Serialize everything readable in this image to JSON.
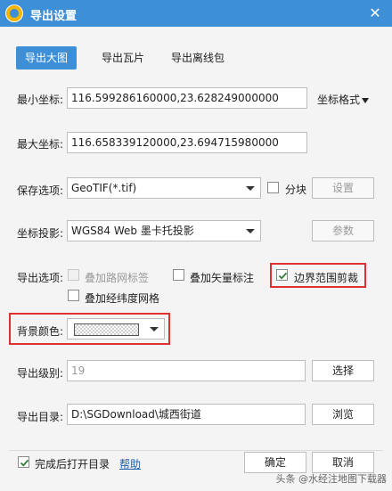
{
  "window": {
    "title": "导出设置",
    "close_glyph": "✕"
  },
  "tabs": [
    {
      "label": "导出大图",
      "active": true
    },
    {
      "label": "导出瓦片",
      "active": false
    },
    {
      "label": "导出离线包",
      "active": false
    }
  ],
  "coords": {
    "min_label": "最小坐标:",
    "min_value": "116.599286160000,23.628249000000",
    "max_label": "最大坐标:",
    "max_value": "116.658339120000,23.694715980000",
    "format_label": "坐标格式"
  },
  "save": {
    "label": "保存选项:",
    "selected": "GeoTIF(*.tif)",
    "tile_label": "分块",
    "tile_checked": false,
    "settings_button": "设置"
  },
  "projection": {
    "label": "坐标投影:",
    "selected": "WGS84 Web 墨卡托投影",
    "params_button": "参数"
  },
  "export_options": {
    "label": "导出选项:",
    "road_labels": {
      "label": "叠加路网标签",
      "checked": false,
      "disabled": true
    },
    "vector_labels": {
      "label": "叠加矢量标注",
      "checked": false,
      "disabled": false
    },
    "boundary_clip": {
      "label": "边界范围剪裁",
      "checked": true,
      "disabled": false
    },
    "graticule": {
      "label": "叠加经纬度网格",
      "checked": false,
      "disabled": false
    }
  },
  "background": {
    "label": "背景颜色:"
  },
  "level": {
    "label": "导出级别:",
    "value": "19",
    "button": "选择"
  },
  "directory": {
    "label": "导出目录:",
    "value": "D:\\SGDownload\\城西街道",
    "button": "浏览"
  },
  "footer": {
    "open_after_label": "完成后打开目录",
    "open_after_checked": true,
    "help_link": "帮助",
    "ok_button": "确定",
    "cancel_button": "取消"
  },
  "watermark": "头条 @水经注地图下载器",
  "colors": {
    "accent": "#3d8fd8",
    "highlight": "#e03131",
    "check": "#2e7d32"
  }
}
